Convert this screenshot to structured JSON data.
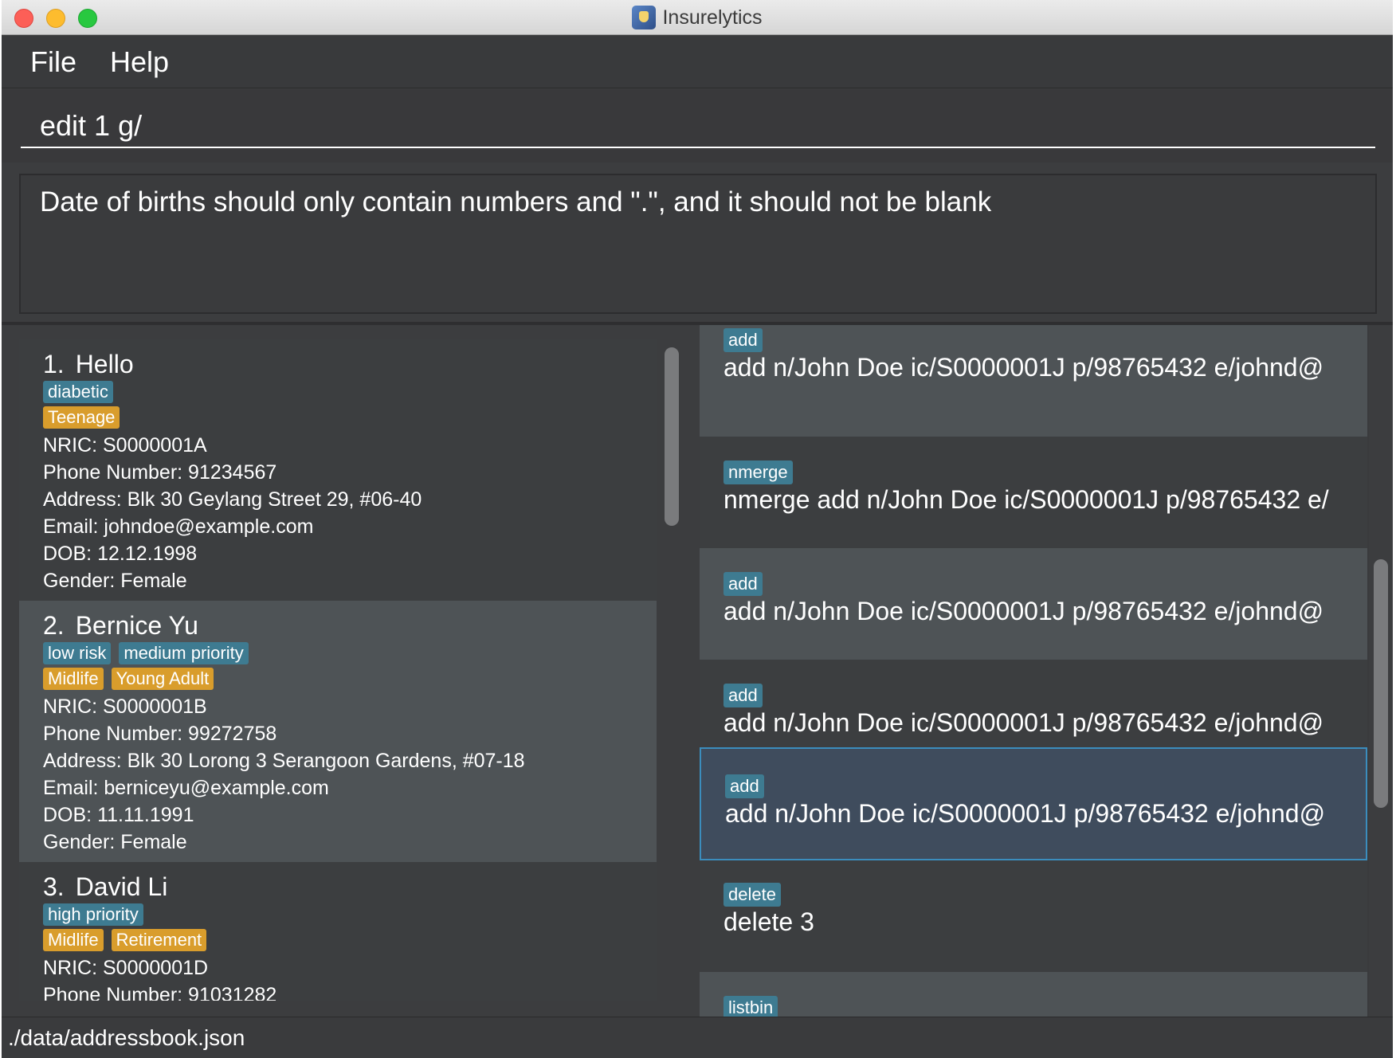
{
  "window": {
    "title": "Insurelytics"
  },
  "menu": {
    "items": [
      "File",
      "Help"
    ]
  },
  "command": {
    "value": "edit 1 g/"
  },
  "result": {
    "message": "Date of births should only contain numbers and \".\", and it should not be blank"
  },
  "persons": [
    {
      "index": "1.",
      "name": "Hello",
      "tags_blue": [
        "diabetic"
      ],
      "tags_orange": [
        "Teenage"
      ],
      "nric": "NRIC: S0000001A",
      "phone": "Phone Number: 91234567",
      "address": "Address: Blk 30 Geylang Street 29, #06-40",
      "email": "Email: johndoe@example.com",
      "dob": "DOB: 12.12.1998",
      "gender": "Gender: Female"
    },
    {
      "index": "2.",
      "name": "Bernice Yu",
      "tags_blue": [
        "low risk",
        "medium priority"
      ],
      "tags_orange": [
        "Midlife",
        "Young Adult"
      ],
      "nric": "NRIC: S0000001B",
      "phone": "Phone Number: 99272758",
      "address": "Address: Blk 30 Lorong 3 Serangoon Gardens, #07-18",
      "email": "Email: berniceyu@example.com",
      "dob": "DOB: 11.11.1991",
      "gender": "Gender: Female"
    },
    {
      "index": "3.",
      "name": "David Li",
      "tags_blue": [
        "high priority"
      ],
      "tags_orange": [
        "Midlife",
        "Retirement"
      ],
      "nric": "NRIC: S0000001D",
      "phone": "Phone Number: 91031282"
    }
  ],
  "history": [
    {
      "tag": "add",
      "command": "add n/John Doe ic/S0000001J p/98765432 e/johnd@"
    },
    {
      "tag": "nmerge",
      "command": "nmerge add n/John Doe ic/S0000001J p/98765432 e/"
    },
    {
      "tag": "add",
      "command": "add n/John Doe ic/S0000001J p/98765432 e/johnd@"
    },
    {
      "tag": "add",
      "command": "add n/John Doe ic/S0000001J p/98765432 e/johnd@"
    },
    {
      "tag": "add",
      "command": "add n/John Doe ic/S0000001J p/98765432 e/johnd@"
    },
    {
      "tag": "delete",
      "command": "delete 3"
    },
    {
      "tag": "listbin",
      "command": ""
    }
  ],
  "status": {
    "path": "./data/addressbook.json"
  },
  "colors": {
    "tag_blue": "#3e7b91",
    "tag_orange": "#d99d2c",
    "selection_border": "#3b8dbd",
    "background": "#3a3b3d"
  }
}
